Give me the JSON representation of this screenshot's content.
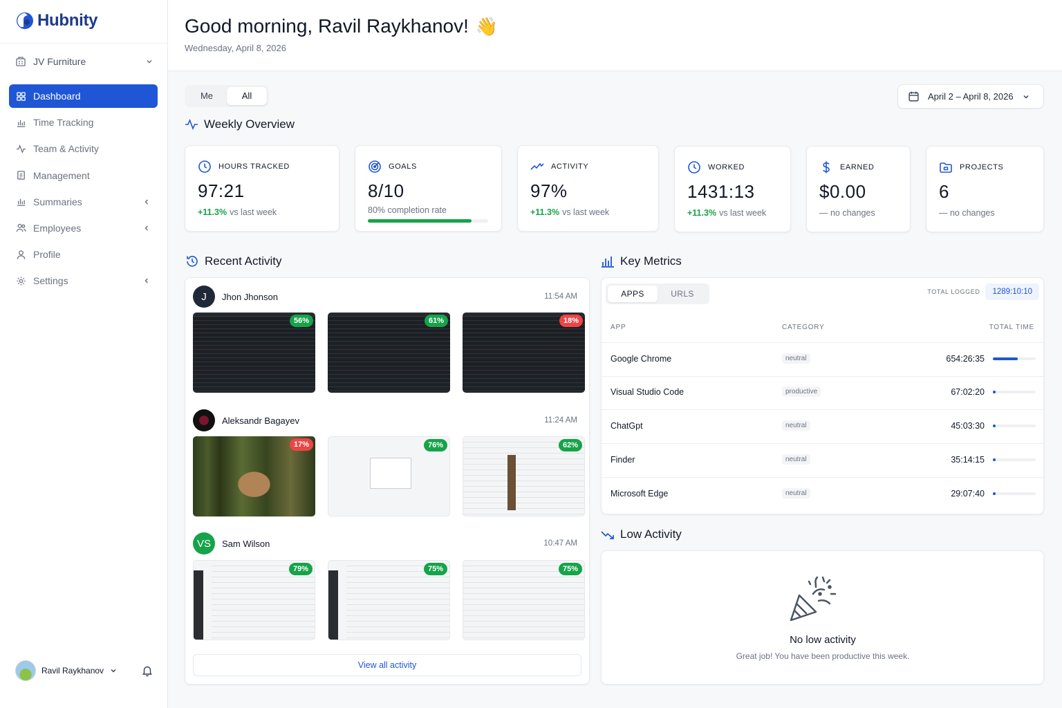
{
  "app": {
    "name": "Hubnity",
    "brand_color": "#1e56d6"
  },
  "org": {
    "name": "JV Furniture"
  },
  "nav": [
    {
      "label": "Dashboard",
      "icon": "grid-icon",
      "active": true
    },
    {
      "label": "Time Tracking",
      "icon": "bar-chart-icon"
    },
    {
      "label": "Team & Activity",
      "icon": "activity-icon"
    },
    {
      "label": "Management",
      "icon": "document-icon"
    },
    {
      "label": "Summaries",
      "icon": "bar-chart-icon",
      "expandable": true
    },
    {
      "label": "Employees",
      "icon": "users-icon",
      "expandable": true
    },
    {
      "label": "Profile",
      "icon": "user-icon"
    },
    {
      "label": "Settings",
      "icon": "gear-icon",
      "expandable": true
    }
  ],
  "user": {
    "name": "Ravil Raykhanov"
  },
  "header": {
    "greeting": "Good morning, Ravil Raykhanov!",
    "emoji": "👋",
    "date": "Wednesday, April 8, 2026"
  },
  "scope_toggle": {
    "options": [
      "Me",
      "All"
    ],
    "selected": "All"
  },
  "date_range": "April 2 – April 8, 2026",
  "weekly": {
    "title": "Weekly Overview",
    "stats": [
      {
        "label": "HOURS TRACKED",
        "value": "97:21",
        "change": "+11.3%",
        "note": "vs last week",
        "icon": "clock-icon"
      },
      {
        "label": "GOALS",
        "value": "8/10",
        "note": "80% completion rate",
        "progress": 0.8,
        "icon": "target-icon"
      },
      {
        "label": "ACTIVITY",
        "value": "97%",
        "change": "+11.3%",
        "note": "vs last week",
        "icon": "trend-icon"
      },
      {
        "label": "WORKED",
        "value": "1431:13",
        "change": "+11.3%",
        "note": "vs last week",
        "icon": "clock-icon"
      },
      {
        "label": "EARNED",
        "value": "$0.00",
        "note": "— no changes",
        "icon": "dollar-icon"
      },
      {
        "label": "PROJECTS",
        "value": "6",
        "note": "— no changes",
        "icon": "folder-icon"
      }
    ]
  },
  "recent": {
    "title": "Recent Activity",
    "rows": [
      {
        "initials": "J",
        "name": "Jhon Jhonson",
        "time": "11:54 AM",
        "shots": [
          {
            "pct": "56%",
            "level": "green"
          },
          {
            "pct": "61%",
            "level": "green"
          },
          {
            "pct": "18%",
            "level": "red"
          }
        ]
      },
      {
        "initials": "",
        "name": "Aleksandr Bagayev",
        "time": "11:24 AM",
        "shots": [
          {
            "pct": "17%",
            "level": "red"
          },
          {
            "pct": "76%",
            "level": "green"
          },
          {
            "pct": "62%",
            "level": "green"
          }
        ]
      },
      {
        "initials": "VS",
        "name": "Sam Wilson",
        "time": "10:47 AM",
        "shots": [
          {
            "pct": "79%",
            "level": "green"
          },
          {
            "pct": "75%",
            "level": "green"
          },
          {
            "pct": "75%",
            "level": "green"
          }
        ]
      }
    ],
    "view_all": "View all activity"
  },
  "metrics": {
    "title": "Key Metrics",
    "tabs": [
      "APPS",
      "URLS"
    ],
    "total_label": "TOTAL LOGGED",
    "total_value": "1289:10:10",
    "columns": [
      "APP",
      "CATEGORY",
      "TOTAL TIME"
    ],
    "rows": [
      {
        "app": "Google Chrome",
        "category": "neutral",
        "time": "654:26:35",
        "share": 0.58
      },
      {
        "app": "Visual Studio Code",
        "category": "productive",
        "time": "67:02:20",
        "share": 0.06
      },
      {
        "app": "ChatGpt",
        "category": "neutral",
        "time": "45:03:30",
        "share": 0.04
      },
      {
        "app": "Finder",
        "category": "neutral",
        "time": "35:14:15",
        "share": 0.03
      },
      {
        "app": "Microsoft Edge",
        "category": "neutral",
        "time": "29:07:40",
        "share": 0.03
      }
    ]
  },
  "low": {
    "title": "Low Activity",
    "empty_title": "No low activity",
    "empty_sub": "Great job! You have been productive this week."
  },
  "colors": {
    "green": "#16a34a",
    "red": "#ef4444",
    "accent": "#1e56d6"
  }
}
